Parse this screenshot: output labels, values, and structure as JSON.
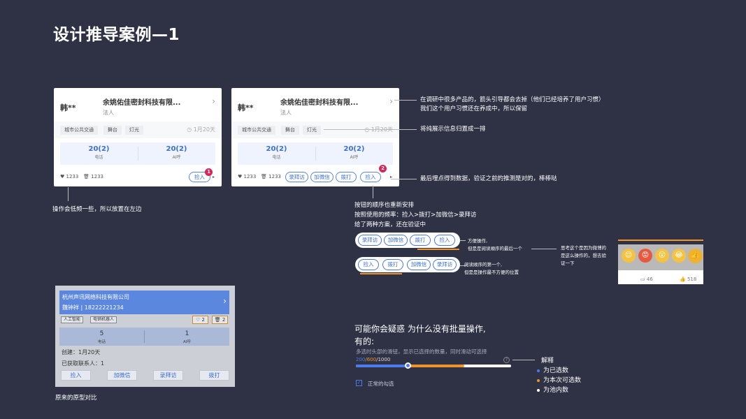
{
  "page_title": "设计推导案例—1",
  "card": {
    "name": "韩**",
    "company": "余姚佑佳密封科技有限...",
    "role": "法人",
    "tags": [
      "城市公共交通",
      "舞台",
      "灯光"
    ],
    "time": "1月20天",
    "stat_call_value": "20(2)",
    "stat_call_label": "电话",
    "stat_ai_value": "20(2)",
    "stat_ai_label": "AI呼",
    "likes": "1233",
    "trash": "1233"
  },
  "card1": {
    "button": "捡入",
    "badge": "1"
  },
  "card2": {
    "buttons": [
      "录拜访",
      "加微信",
      "拨打",
      "捡入"
    ],
    "badge": "2"
  },
  "notes": {
    "arrow_note_1": "在调研中很多产品的，箭头引导都会去掉（他们已经培养了用户习惯）",
    "arrow_note_2": "我们这个用户习惯还在养成中，所以保留",
    "info_note": "将纯展示信息归置成一排",
    "data_note": "最后埋点得到数据，验证之前的推测是对的，棒棒哒",
    "left_note": "操作会低频一些，所以放置在左边",
    "order_1": "按钮的顺序也重新安排",
    "order_2": "按照使用的频率：捡入>拨打>加微信>录拜访",
    "order_3": "给了两种方案，还在验证中",
    "optA_1": "方便操作,",
    "optA_2": "但是是阅读顺序的最后一个",
    "optB_1": "阅读顺序的第一个,",
    "optB_2": "但是是操作最不方便的位置",
    "weibo_1": "思考这个是因为微博的",
    "weibo_2": "是这么操作的，想去验",
    "weibo_3": "证一下",
    "proto_caption": "原来的原型对比"
  },
  "optionA": [
    "录拜访",
    "加微信",
    "拨打",
    "捡入"
  ],
  "optionB": [
    "捡入",
    "拨打",
    "加微信",
    "录拜访"
  ],
  "weibo": {
    "comments": "46",
    "likes": "518"
  },
  "proto": {
    "company": "杭州声讯网络科技有限公司",
    "person": "魏钟祥 | 18222221234",
    "tags": [
      "人工智能",
      "电销机器人"
    ],
    "like_count": "2",
    "trash_count": "2",
    "call_value": "5",
    "call_label": "电话",
    "ai_value": "1",
    "ai_label": "AI呼",
    "created": "创建：1月20天",
    "contacts": "已获取联系人：1",
    "buttons": [
      "捡入",
      "加微信",
      "录拜访",
      "拨打"
    ]
  },
  "batch": {
    "question_1": "可能你会疑惑 为什么没有批量操作,",
    "question_2": "有的:",
    "desc": "多选时头部的滑钮，显示已选择的数量，同时滑动可选择",
    "count_selected": "200",
    "count_selectable": "/600",
    "count_pool": "/1000",
    "help": "?",
    "checkbox_label": "正常的勾选",
    "legend_title": "解释",
    "legend": [
      "为已选数",
      "为本次可选数",
      "为池内数"
    ],
    "colors": {
      "selected": "#4b7bec",
      "selectable": "#f0932b",
      "pool": "#ffffff"
    },
    "slider_selected_fraction": 0.333,
    "slider_selectable_fraction": 0.6
  }
}
